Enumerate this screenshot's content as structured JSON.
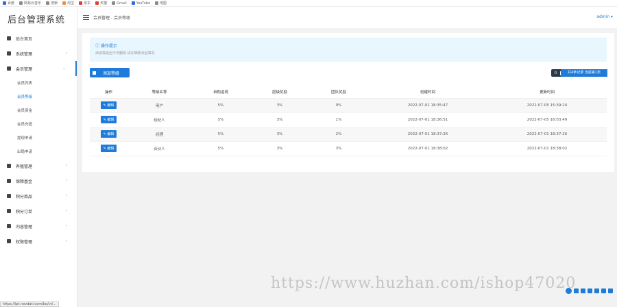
{
  "bookmarks": [
    "百度",
    "网易云音乐",
    "搜索",
    "淘宝",
    "京东",
    "天猫",
    "Gmail",
    "YouTube",
    "地图"
  ],
  "logo": "后台管理系统",
  "menu": [
    {
      "label": "后台首页",
      "arrow": ""
    },
    {
      "label": "系统管理",
      "arrow": "›"
    },
    {
      "label": "会员管理",
      "arrow": "⌄"
    },
    {
      "label": "养殖管理",
      "arrow": "›"
    },
    {
      "label": "保障基金",
      "arrow": "›"
    },
    {
      "label": "积分商品",
      "arrow": "›"
    },
    {
      "label": "积分订单",
      "arrow": "›"
    },
    {
      "label": "内容管理",
      "arrow": "›"
    },
    {
      "label": "权限管理",
      "arrow": "›"
    }
  ],
  "submenu": [
    "会员列表",
    "会员等级",
    "会员资金",
    "会员充值",
    "提现申请",
    "出局申请"
  ],
  "header": {
    "crumb": "会员管理 - 会员等级",
    "user": "admin ▾"
  },
  "tip": {
    "title": "ⓘ 操作提示",
    "desc": "添加等级后不可删除 请仔细核对后填写"
  },
  "add_label": "添加等级",
  "total": {
    "zero": "0",
    "label": "共4条记录 当前第1页"
  },
  "table": {
    "headers": [
      "操作",
      "等级名称",
      "自购返现",
      "层级奖励",
      "团队奖励",
      "创建时间",
      "更新时间"
    ],
    "edit_label": "✎ 编辑",
    "rows": [
      [
        "用户",
        "5%",
        "3%",
        "0%",
        "2022-07-01 18:35:47",
        "2022-07-05 15:39:24"
      ],
      [
        "经纪人",
        "5%",
        "3%",
        "1%",
        "2022-07-01 18:36:51",
        "2022-07-05 16:03:49"
      ],
      [
        "经理",
        "5%",
        "3%",
        "2%",
        "2022-07-01 18:37:26",
        "2022-07-01 18:37:26"
      ],
      [
        "合伙人",
        "5%",
        "3%",
        "3%",
        "2022-07-01 18:38:02",
        "2022-07-01 18:38:02"
      ]
    ]
  },
  "status_url": "https://ipt.nevdati.com/bo/vt/...",
  "watermark": "https://www.huzhan.com/ishop47020"
}
